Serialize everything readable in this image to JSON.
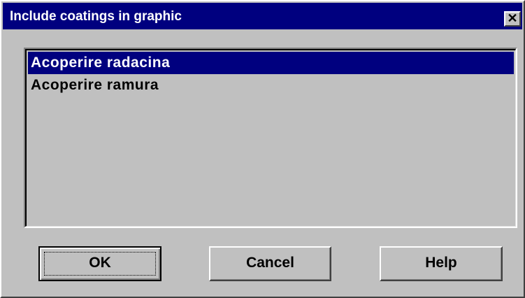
{
  "window": {
    "title": "Include coatings in graphic",
    "close_glyph": "✕"
  },
  "list": {
    "items": [
      {
        "label": "Acoperire radacina",
        "selected": true
      },
      {
        "label": "Acoperire ramura",
        "selected": false
      }
    ]
  },
  "buttons": {
    "ok_label": "OK",
    "cancel_label": "Cancel",
    "help_label": "Help"
  },
  "colors": {
    "titlebar": "#00007f",
    "face": "#c0c0c0",
    "selection": "#00007f"
  }
}
